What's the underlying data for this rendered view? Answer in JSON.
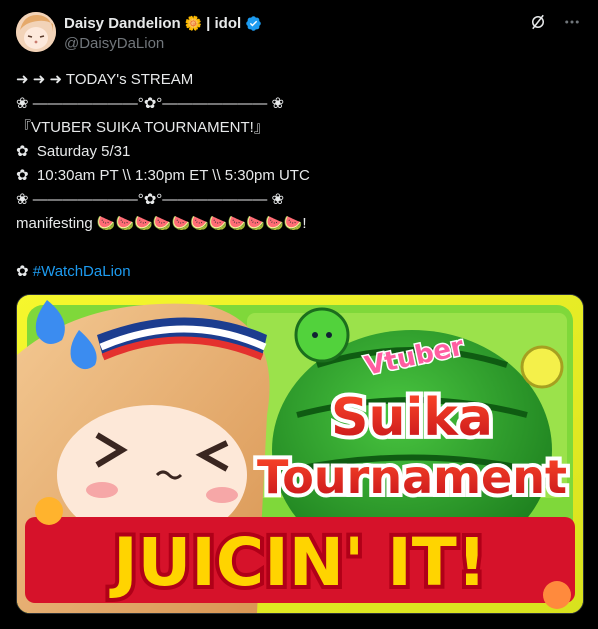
{
  "author": {
    "display_name": "Daisy Dandelion",
    "flower": "🌼",
    "tag": "| idol",
    "handle": "@DaisyDaLion",
    "verified": true
  },
  "actions": {
    "grok_icon": "grok-icon",
    "more_icon": "more-icon"
  },
  "post": {
    "lines": [
      "➜ ➜ ➜ TODAY's STREAM",
      "❀ ———————°✿°——————— ❀",
      "『VTUBER SUIKA TOURNAMENT!』",
      "✿  Saturday 5/31",
      "✿  10:30am PT \\\\ 1:30pm ET \\\\ 5:30pm UTC",
      "❀ ———————°✿°——————— ❀",
      "manifesting 🍉🍉🍉🍉🍉🍉🍉🍉🍉🍉🍉!"
    ],
    "hashtag_prefix": "✿ ",
    "hashtag": "#WatchDaLion"
  },
  "media": {
    "title_small": "Vtuber",
    "title_line1": "Suika",
    "title_line2": "Tournament",
    "banner": "JUICIN' IT!"
  },
  "colors": {
    "background": "#000000",
    "text": "#e7e9ea",
    "muted": "#71767b",
    "link": "#1d9bf0",
    "verified": "#1d9bf0"
  }
}
